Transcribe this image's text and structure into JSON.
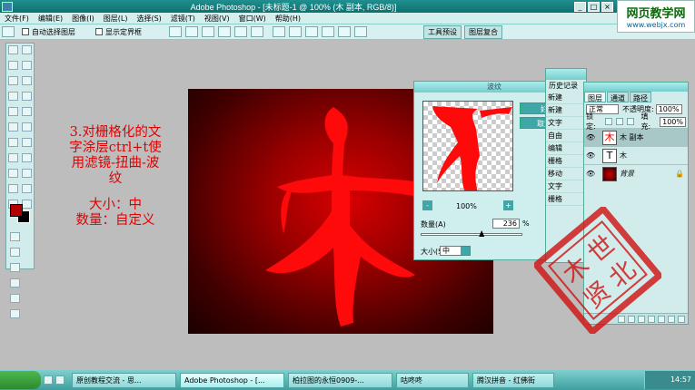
{
  "app": {
    "title": "Adobe Photoshop - [未标题-1 @ 100% (木 副本, RGB/8)]",
    "win_min": "_",
    "win_max": "□",
    "win_close": "×"
  },
  "menu": [
    "文件(F)",
    "编辑(E)",
    "图像(I)",
    "图层(L)",
    "选择(S)",
    "滤镜(T)",
    "视图(V)",
    "窗口(W)",
    "帮助(H)"
  ],
  "options": {
    "auto_select": "自动选择图层",
    "show_bounds": "显示定界框",
    "tab_tool_presets": "工具预设",
    "tab_layer_comps": "图层复合"
  },
  "watermark": {
    "title": "网页教学网",
    "url": "www.webjx.com"
  },
  "instructions": {
    "line1": "3.对栅格化的文",
    "line2": "字涂层ctrl+t使",
    "line3": "用滤镜-扭曲-波",
    "line4": "纹",
    "line5": "大小：中",
    "line6": "数量：自定义"
  },
  "canvas_glyph": "木",
  "dialog": {
    "title": "波纹",
    "ok": "好",
    "cancel": "取消",
    "zoom": "100%",
    "zoom_out": "-",
    "zoom_in": "+",
    "amount_label": "数量(A)",
    "amount_value": "236",
    "amount_unit": "%",
    "amount_level": 0.6,
    "size_label": "大小(S)",
    "size_value": "中"
  },
  "history": {
    "tab": "历史记录",
    "items": [
      "新建",
      "新建",
      "文字",
      "自由",
      "编辑",
      "栅格",
      "移动",
      "文字",
      "栅格"
    ]
  },
  "layers": {
    "tabs": [
      "图层",
      "通道",
      "路径"
    ],
    "blend_mode": "正常",
    "opacity_label": "不透明度:",
    "opacity_value": "100%",
    "lock_label": "锁定:",
    "fill_label": "填充:",
    "fill_value": "100%",
    "items": [
      {
        "thumb": "木",
        "name": "木 副本"
      },
      {
        "thumb": "T",
        "name": "木"
      },
      {
        "thumb": "",
        "name": "背景"
      }
    ]
  },
  "stamp": {
    "chars": [
      "木",
      "世",
      "贤",
      "北"
    ]
  },
  "taskbar": {
    "tasks": [
      "原创教程交流 - 思...",
      "Adobe Photoshop - [...",
      "柏拉图的永恒0909-...",
      "咕咚咚",
      "腾汉拼音 - 红佛街"
    ],
    "clock": "14:57"
  },
  "colors": {
    "accent": "#3fa7a7",
    "text_red": "#e00000",
    "foreground": "#b00000"
  }
}
